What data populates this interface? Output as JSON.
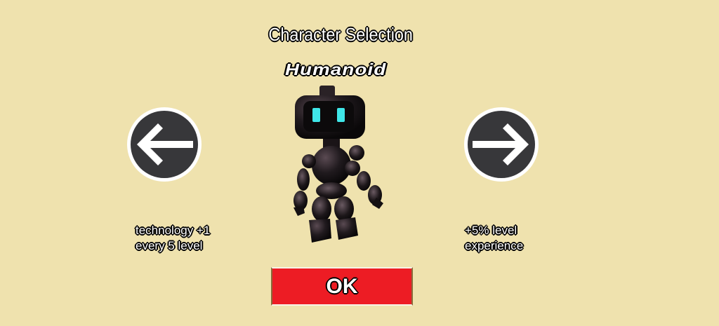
{
  "screen": {
    "title": "Character Selection"
  },
  "character": {
    "name": "Humanoid",
    "bonus_left": "technology +1 every 5 level",
    "bonus_right": "+5% level experience",
    "eye_color": "#3fe6e8"
  },
  "controls": {
    "prev_icon": "arrow-left-icon",
    "next_icon": "arrow-right-icon",
    "ok_label": "OK"
  },
  "colors": {
    "background": "#efe2ae",
    "arrow_button": "#37373a",
    "ok_button": "#ed1c24"
  }
}
